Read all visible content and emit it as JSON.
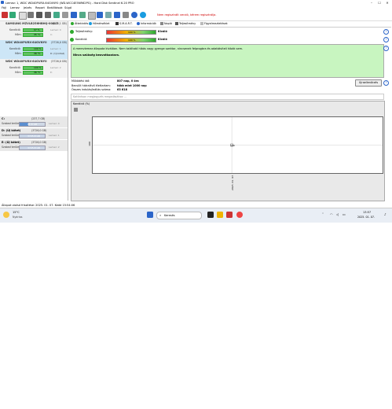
{
  "window": {
    "title": "Lemez: 1, WDC WD40PURX-64GVNY0 (WD-WCC4E5NR62PG) - Hard Disk Sentinel 6.20 PRO",
    "controls": [
      "–",
      "☐",
      "✕"
    ]
  },
  "menu": [
    "Fájl",
    "Lemez",
    "Jelzés",
    "Report",
    "Beállítások",
    "Súgó"
  ],
  "notice": "Nem regisztrált verzió, kérem regisztrálja.",
  "disks": [
    {
      "name": "SAMSUNG MZVLB256HBHQ-000L7",
      "size": "(256,1 GB)",
      "health_label": "Kondíció:",
      "health_value": "97 %",
      "health_pct": 97,
      "health_extra": "Lemez: 0",
      "temp_label": "Hőm:",
      "temp_value": "35 °C",
      "temp_extra": "C:"
    },
    {
      "name": "WDC WD40PURX-64GVNY0",
      "size": "(3726,0 GB)",
      "health_label": "Kondíció:",
      "health_value": "100 %",
      "health_pct": 100,
      "health_extra": "Lemez: 1",
      "temp_label": "Hőm:",
      "temp_value": "36 °C",
      "temp_extra": "D: (Új kötet)"
    },
    {
      "name": "WDC WD40PURX-64GVNY0",
      "size": "(3726,0 GB)",
      "health_label": "Kondíció:",
      "health_value": "100 %",
      "health_pct": 100,
      "health_extra": "Lemez: 2",
      "temp_label": "Hőm:",
      "temp_value": "36 °C",
      "temp_extra": "E:"
    }
  ],
  "volumes": [
    {
      "name": "C:",
      "size": "(237,7 GB)",
      "free_label": "Szabad terület:",
      "free_value": "81,6 GB",
      "free_pct": 34,
      "disk": "Lemez: 0"
    },
    {
      "name": "D: (Új kötet)",
      "size": "(3726,0 GB)",
      "free_label": "Szabad terület:",
      "free_value": "3725,8 GB",
      "free_pct": 100,
      "disk": "Lemez: 1"
    },
    {
      "name": "E: (Új kötet)",
      "size": "(3726,0 GB)",
      "free_label": "Szabad terület:",
      "free_value": "3725,8 GB",
      "free_pct": 100,
      "disk": "Lemez: 2"
    }
  ],
  "tabs": [
    "Áttekintés",
    "Hőmérséklet",
    "S.M.A.R.T.",
    "Információk",
    "Napló",
    "Teljesítmény",
    "Figyelmeztetések"
  ],
  "status_rows": [
    {
      "label": "Teljesítmény:",
      "value": "100 %",
      "pct": 100,
      "state": "Kiváló"
    },
    {
      "label": "Kondíció:",
      "value": "100 %",
      "pct": 100,
      "state": "Kiváló"
    }
  ],
  "health_panel": {
    "line1": "A merevlemez állapota kiválóan. Nem találtató hibás vagy gyenge szektor, nincsenek felprogbra és adatátviteli hibák sem.",
    "line2": "Nincs szükség beavatkozásra."
  },
  "info": {
    "power_on_label": "Működési idő:",
    "power_on_value": "807 nap, 0 óra",
    "remaining_label": "Becsült hátralévő élettartam:",
    "remaining_value": "több mint 1000 nap",
    "starts_label": "Összes indulás/leállás száma:",
    "starts_value": "63 618",
    "repeat_button": "Újraellenőrzés"
  },
  "comment_placeholder": "Kattintson megjegyzés megadásához ...",
  "chart_title": "Kondíció (%)",
  "chart_data": {
    "type": "line",
    "title": "Kondíció (%)",
    "x": [
      "2025. 01. 07."
    ],
    "series": [
      {
        "values": [
          100
        ]
      }
    ],
    "y_tick_labels": [
      "100"
    ],
    "point_label": "100"
  },
  "status_bar": "Állapot utolsó frissítése: 2025. 01. 07. Kedd 15:54:06",
  "taskbar": {
    "weather_temp": "15°C",
    "weather_text": "Nyárias",
    "search_placeholder": "Keresés",
    "time": "13:57",
    "date": "2025. 01. 07."
  },
  "colors": {
    "accent": "#2b65c9",
    "ok": "#2ea92e",
    "panel": "#c8f5c0",
    "notice": "#d00000"
  }
}
